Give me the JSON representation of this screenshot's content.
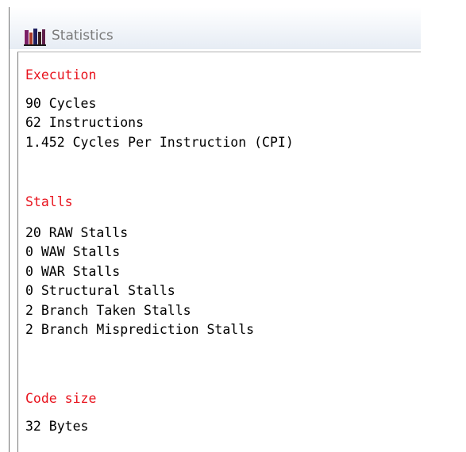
{
  "window": {
    "title": "Statistics",
    "icon": "bar-chart-app-icon"
  },
  "colors": {
    "heading": "#e8141e",
    "body_text": "#000000",
    "title_text": "#7b7b7b",
    "icon_purple": "#6b1f5e"
  },
  "sections": [
    {
      "heading": "Execution",
      "lines": [
        "90 Cycles",
        "62 Instructions",
        "1.452 Cycles Per Instruction (CPI)"
      ]
    },
    {
      "heading": "Stalls",
      "lines": [
        "20 RAW Stalls",
        "0 WAW Stalls",
        "0 WAR Stalls",
        "0 Structural Stalls",
        "2 Branch Taken Stalls",
        "2 Branch Misprediction Stalls"
      ]
    },
    {
      "heading": "Code size",
      "lines": [
        "32 Bytes"
      ]
    }
  ]
}
